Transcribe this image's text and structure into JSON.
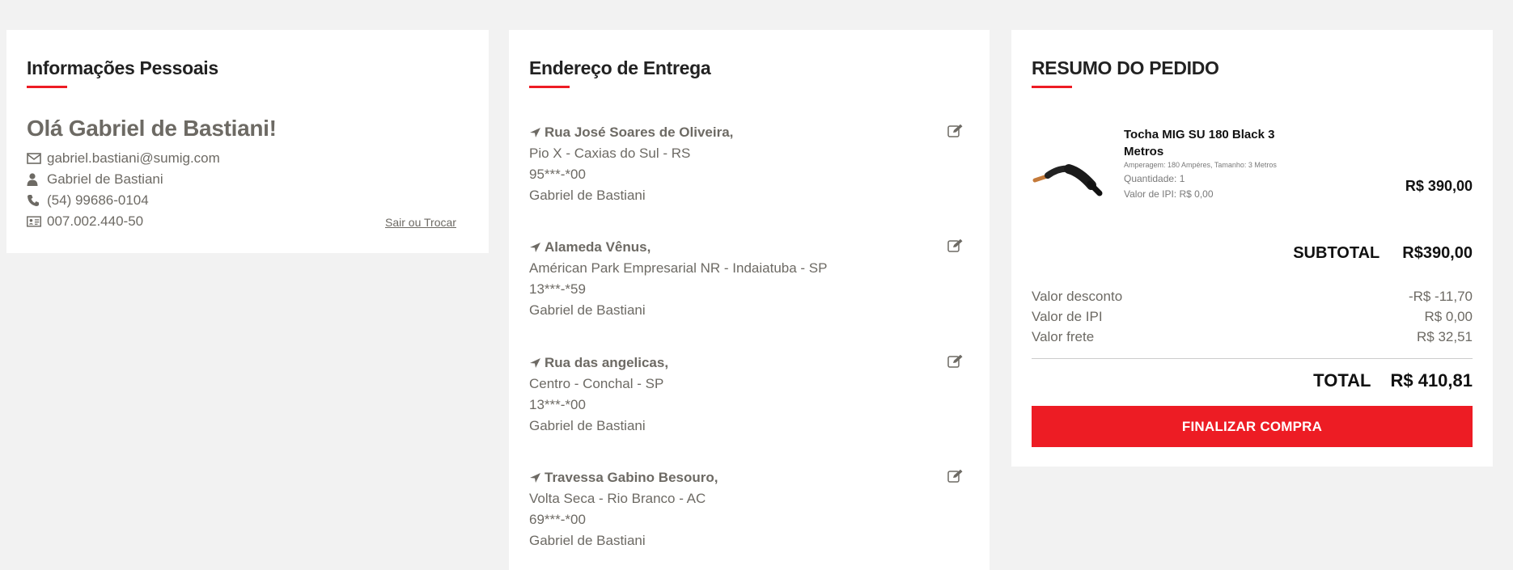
{
  "personal": {
    "title": "Informações Pessoais",
    "greeting": "Olá Gabriel de Bastiani!",
    "email": "gabriel.bastiani@sumig.com",
    "name": "Gabriel de Bastiani",
    "phone": "(54) 99686-0104",
    "document": "007.002.440-50",
    "logout_label": "Sair ou Trocar"
  },
  "delivery": {
    "title": "Endereço de Entrega",
    "addresses": [
      {
        "street": "Rua José Soares de Oliveira,",
        "district": "Pio X - Caxias do Sul - RS",
        "zip": "95***-*00",
        "recipient": "Gabriel de Bastiani"
      },
      {
        "street": "Alameda Vênus,",
        "district": "Américan Park Empresarial NR - Indaiatuba - SP",
        "zip": "13***-*59",
        "recipient": "Gabriel de Bastiani"
      },
      {
        "street": "Rua das angelicas,",
        "district": "Centro - Conchal - SP",
        "zip": "13***-*00",
        "recipient": "Gabriel de Bastiani"
      },
      {
        "street": "Travessa Gabino Besouro,",
        "district": "Volta Seca - Rio Branco - AC",
        "zip": "69***-*00",
        "recipient": "Gabriel de Bastiani"
      }
    ]
  },
  "summary": {
    "title": "RESUMO DO PEDIDO",
    "product": {
      "name": "Tocha MIG SU 180 Black 3 Metros",
      "spec": "Amperagem: 180 Ampéres, Tamanho: 3 Metros",
      "quantity": "Quantidade: 1",
      "ipi": "Valor de IPI: R$ 0,00",
      "price": "R$ 390,00"
    },
    "subtotal_label": "SUBTOTAL",
    "subtotal_value": "R$390,00",
    "fees": [
      {
        "label": "Valor desconto",
        "value": "-R$ -11,70"
      },
      {
        "label": "Valor de IPI",
        "value": "R$ 0,00"
      },
      {
        "label": "Valor frete",
        "value": "R$ 32,51"
      }
    ],
    "total_label": "TOTAL",
    "total_value": "R$ 410,81",
    "finish_label": "FINALIZAR COMPRA"
  },
  "colors": {
    "accent": "#ed1c24",
    "text_muted": "#6d6a64",
    "background": "#f2f2f2"
  }
}
